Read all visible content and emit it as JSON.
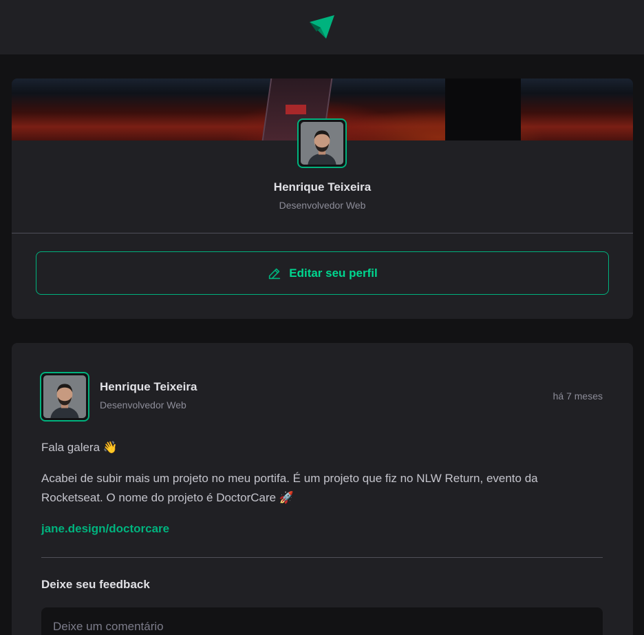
{
  "colors": {
    "background": "#121214",
    "card": "#202024",
    "accent": "#00b37e",
    "text": "#e1e1e6",
    "muted": "#8d8d99"
  },
  "header": {
    "logo_icon": "ignite-logo-icon"
  },
  "profile": {
    "name": "Henrique Teixeira",
    "role": "Desenvolvedor Web",
    "edit_button_label": "Editar seu perfil",
    "edit_icon": "pencil-icon"
  },
  "post": {
    "author": {
      "name": "Henrique Teixeira",
      "role": "Desenvolvedor Web"
    },
    "published": "há 7 meses",
    "content": {
      "greeting": "Fala galera 👋",
      "body": "Acabei de subir mais um projeto no meu portifa. É um projeto que fiz no NLW Return, evento da Rocketseat. O nome do projeto é DoctorCare 🚀",
      "link": "jane.design/doctorcare"
    },
    "feedback": {
      "title": "Deixe seu feedback",
      "placeholder": "Deixe um comentário"
    }
  }
}
